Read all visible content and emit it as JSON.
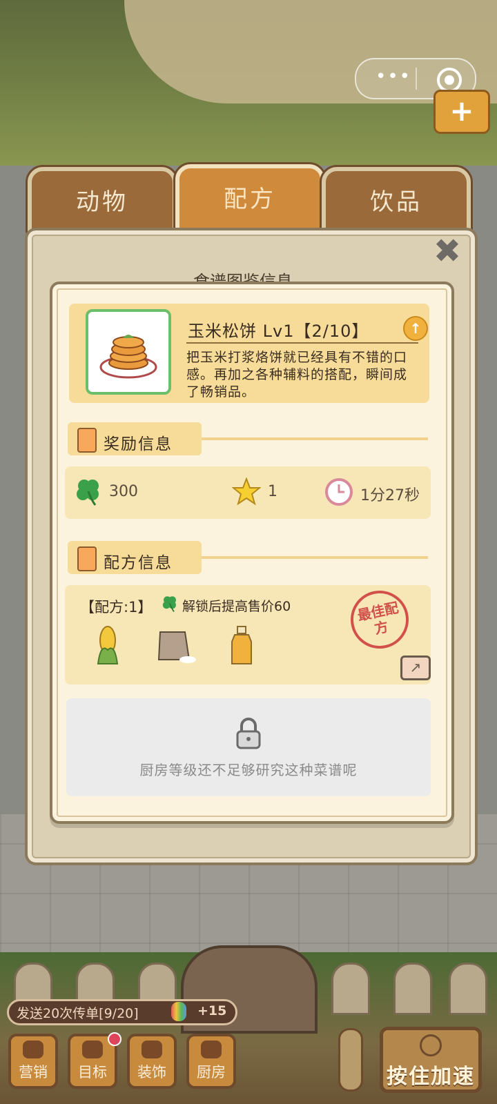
{
  "tabs": [
    {
      "label": "动物",
      "active": false
    },
    {
      "label": "配方",
      "active": true
    },
    {
      "label": "饮品",
      "active": false
    }
  ],
  "panel": {
    "behind_title": "食谱图鉴信息",
    "close_icon": "close-icon"
  },
  "item": {
    "name": "玉米松饼 Lv1【2/10】",
    "description": "把玉米打浆烙饼就已经具有不错的口感。再加之各种辅料的搭配，瞬间成了畅销品。",
    "image_icon": "corn-pancake-stack-icon",
    "upgrade_icon": "upgrade-arrow-icon"
  },
  "reward_section": {
    "title": "奖励信息",
    "clover_value": "300",
    "star_value": "1",
    "time_value": "1分27秒"
  },
  "recipe_section": {
    "title": "配方信息",
    "count_label": "【配方:1】",
    "bonus_text": "解锁后提高售价60",
    "ingredients": [
      "corn-icon",
      "flour-sack-icon",
      "oil-bottle-icon"
    ],
    "stamp_text": "最佳配方"
  },
  "locked": {
    "text": "厨房等级还不足够研究这种菜谱呢"
  },
  "hud": {
    "quest_text": "发送20次传单[9/20]",
    "quest_reward": "+15",
    "buttons": [
      "营销",
      "目标",
      "装饰",
      "厨房"
    ],
    "speed_label": "按住加速"
  },
  "colors": {
    "accent_orange": "#d08a3c",
    "card_yellow": "#f6dc98",
    "clover_green": "#3aa04a",
    "stamp_red": "#d2504a"
  }
}
